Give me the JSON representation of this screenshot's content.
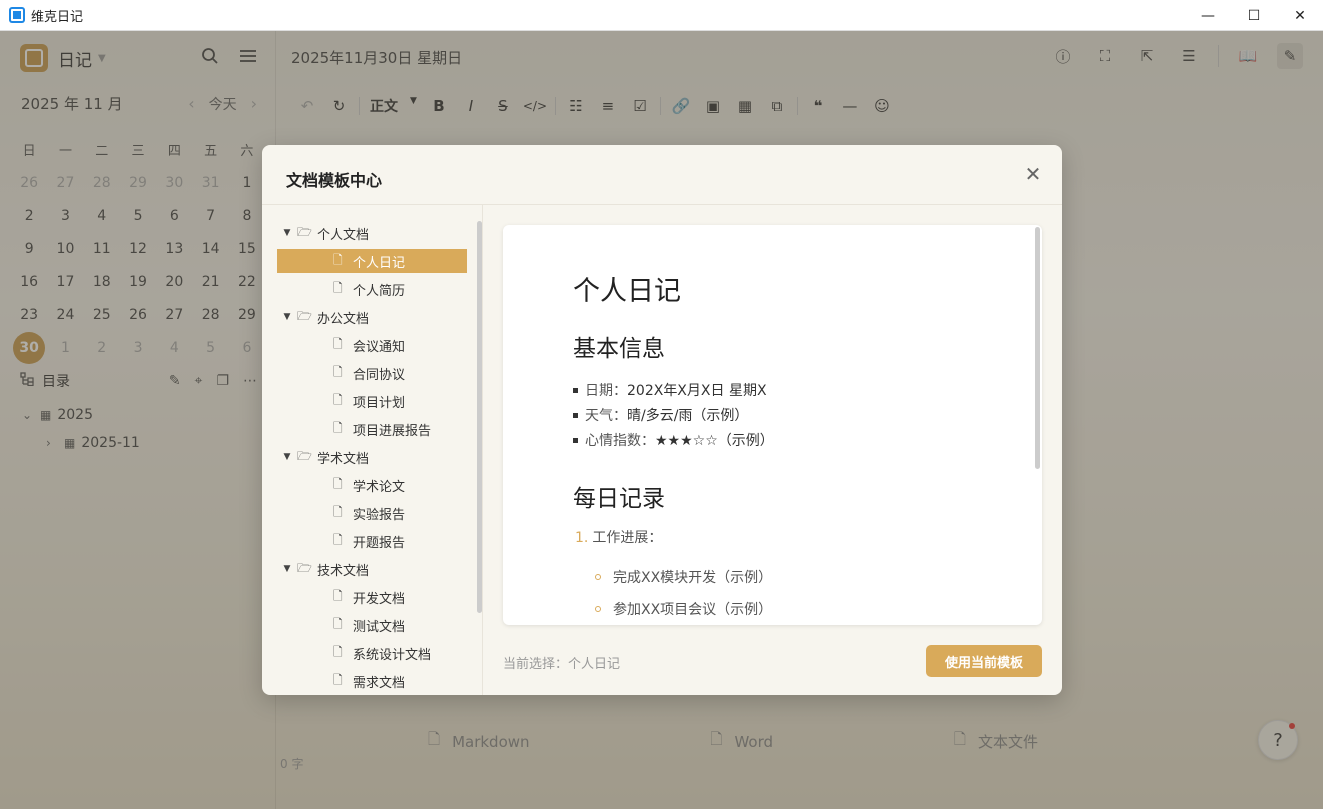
{
  "window": {
    "title": "维克日记",
    "minimize": "—",
    "maximize": "☐",
    "close": "✕"
  },
  "sidebar": {
    "brand": "日记",
    "calendar": {
      "month": "2025 年 11 月",
      "today_label": "今天",
      "weekdays": [
        "日",
        "一",
        "二",
        "三",
        "四",
        "五",
        "六"
      ],
      "days": [
        {
          "d": "26",
          "dim": true
        },
        {
          "d": "27",
          "dim": true
        },
        {
          "d": "28",
          "dim": true
        },
        {
          "d": "29",
          "dim": true
        },
        {
          "d": "30",
          "dim": true
        },
        {
          "d": "31",
          "dim": true
        },
        {
          "d": "1"
        },
        {
          "d": "2"
        },
        {
          "d": "3"
        },
        {
          "d": "4"
        },
        {
          "d": "5"
        },
        {
          "d": "6"
        },
        {
          "d": "7"
        },
        {
          "d": "8"
        },
        {
          "d": "9"
        },
        {
          "d": "10"
        },
        {
          "d": "11"
        },
        {
          "d": "12"
        },
        {
          "d": "13"
        },
        {
          "d": "14"
        },
        {
          "d": "15"
        },
        {
          "d": "16"
        },
        {
          "d": "17"
        },
        {
          "d": "18"
        },
        {
          "d": "19"
        },
        {
          "d": "20"
        },
        {
          "d": "21"
        },
        {
          "d": "22"
        },
        {
          "d": "23"
        },
        {
          "d": "24"
        },
        {
          "d": "25"
        },
        {
          "d": "26"
        },
        {
          "d": "27"
        },
        {
          "d": "28"
        },
        {
          "d": "29"
        },
        {
          "d": "30",
          "today": true
        },
        {
          "d": "1",
          "dim": true
        },
        {
          "d": "2",
          "dim": true
        },
        {
          "d": "3",
          "dim": true
        },
        {
          "d": "4",
          "dim": true
        },
        {
          "d": "5",
          "dim": true
        },
        {
          "d": "6",
          "dim": true
        }
      ]
    },
    "toc": {
      "title": "目录",
      "year": "2025",
      "month": "2025-11"
    },
    "word_count": "0 字"
  },
  "main": {
    "date_title": "2025年11月30日 星期日",
    "toolbar": {
      "format": "正文"
    },
    "new_files": [
      "Markdown",
      "Word",
      "文本文件"
    ],
    "help": "?"
  },
  "modal": {
    "title": "文档模板中心",
    "groups": [
      {
        "name": "个人文档",
        "items": [
          "个人日记",
          "个人简历"
        ]
      },
      {
        "name": "办公文档",
        "items": [
          "会议通知",
          "合同协议",
          "项目计划",
          "项目进展报告"
        ]
      },
      {
        "name": "学术文档",
        "items": [
          "学术论文",
          "实验报告",
          "开题报告"
        ]
      },
      {
        "name": "技术文档",
        "items": [
          "开发文档",
          "测试文档",
          "系统设计文档",
          "需求文档"
        ]
      }
    ],
    "selected": "个人日记",
    "preview": {
      "title": "个人日记",
      "section1": "基本信息",
      "info": [
        {
          "label": "日期：",
          "value": "202X年X月X日 星期X"
        },
        {
          "label": "天气：",
          "value": "晴/多云/雨（示例）"
        },
        {
          "label": "心情指数：",
          "value": "★★★☆☆（示例）"
        }
      ],
      "section2": "每日记录",
      "ordered_item": "工作进展：",
      "sub_items": [
        "完成XX模块开发（示例）",
        "参加XX项目会议（示例）"
      ]
    },
    "selection_label": "当前选择：",
    "selection_value": "个人日记",
    "use_button": "使用当前模板"
  }
}
